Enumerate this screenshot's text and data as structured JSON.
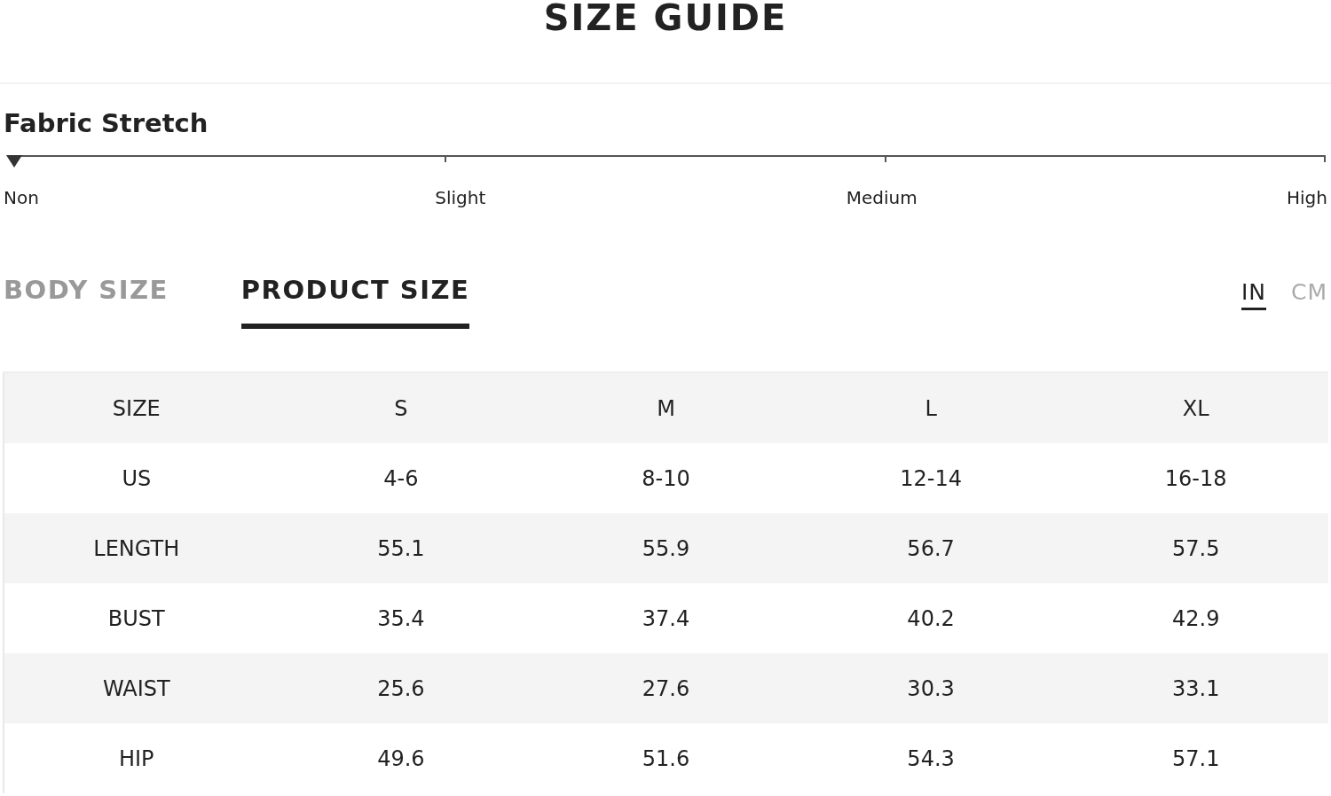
{
  "title": "SIZE GUIDE",
  "fabric_stretch": {
    "heading": "Fabric Stretch",
    "level": 0,
    "labels": [
      "Non",
      "Slight",
      "Medium",
      "High"
    ]
  },
  "tabs": [
    {
      "label": "BODY SIZE",
      "selected": false
    },
    {
      "label": "PRODUCT SIZE",
      "selected": true
    }
  ],
  "units": [
    {
      "label": "IN",
      "selected": true
    },
    {
      "label": "CM",
      "selected": false
    }
  ],
  "table": {
    "columns": [
      "SIZE",
      "S",
      "M",
      "L",
      "XL"
    ],
    "rows": [
      [
        "US",
        "4-6",
        "8-10",
        "12-14",
        "16-18"
      ],
      [
        "LENGTH",
        "55.1",
        "55.9",
        "56.7",
        "57.5"
      ],
      [
        "BUST",
        "35.4",
        "37.4",
        "40.2",
        "42.9"
      ],
      [
        "WAIST",
        "25.6",
        "27.6",
        "30.3",
        "33.1"
      ],
      [
        "HIP",
        "49.6",
        "51.6",
        "54.3",
        "57.1"
      ]
    ]
  }
}
